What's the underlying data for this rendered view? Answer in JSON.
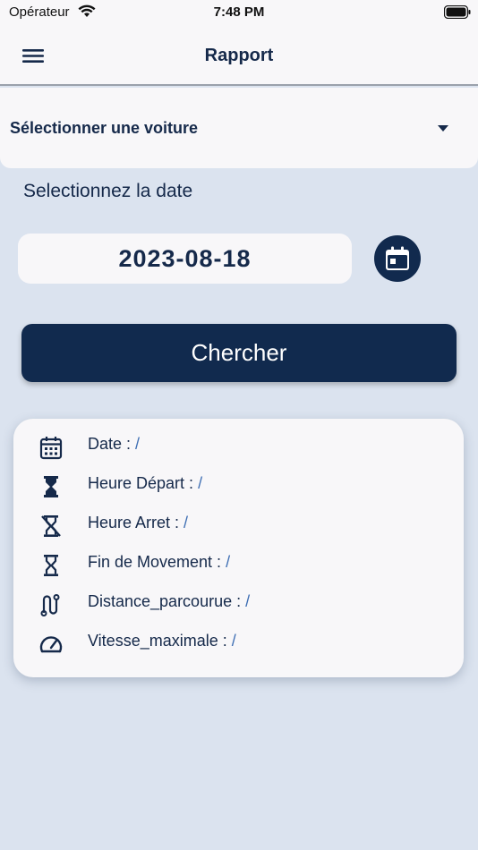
{
  "status_bar": {
    "carrier": "Opérateur",
    "time": "7:48 PM"
  },
  "nav": {
    "title": "Rapport"
  },
  "car_select": {
    "placeholder": "Sélectionner une voiture"
  },
  "date_section": {
    "prompt": "Selectionnez la date",
    "selected_date": "2023-08-18"
  },
  "search_button": {
    "label": "Chercher"
  },
  "info": {
    "rows": [
      {
        "label": "Date : ",
        "value": "/",
        "icon": "calendar-icon"
      },
      {
        "label": "Heure Départ : ",
        "value": "/",
        "icon": "hourglass-full-icon"
      },
      {
        "label": "Heure Arret : ",
        "value": "/",
        "icon": "hourglass-disabled-icon"
      },
      {
        "label": "Fin de Movement : ",
        "value": "/",
        "icon": "hourglass-empty-icon"
      },
      {
        "label": "Distance_parcourue : ",
        "value": "/",
        "icon": "route-icon"
      },
      {
        "label": "Vitesse_maximale : ",
        "value": "/",
        "icon": "speedometer-icon"
      }
    ]
  },
  "colors": {
    "primary": "#112a4e",
    "background": "#dbe3ef",
    "surface": "#f8f7f9",
    "value_accent": "#3f6fb4"
  }
}
